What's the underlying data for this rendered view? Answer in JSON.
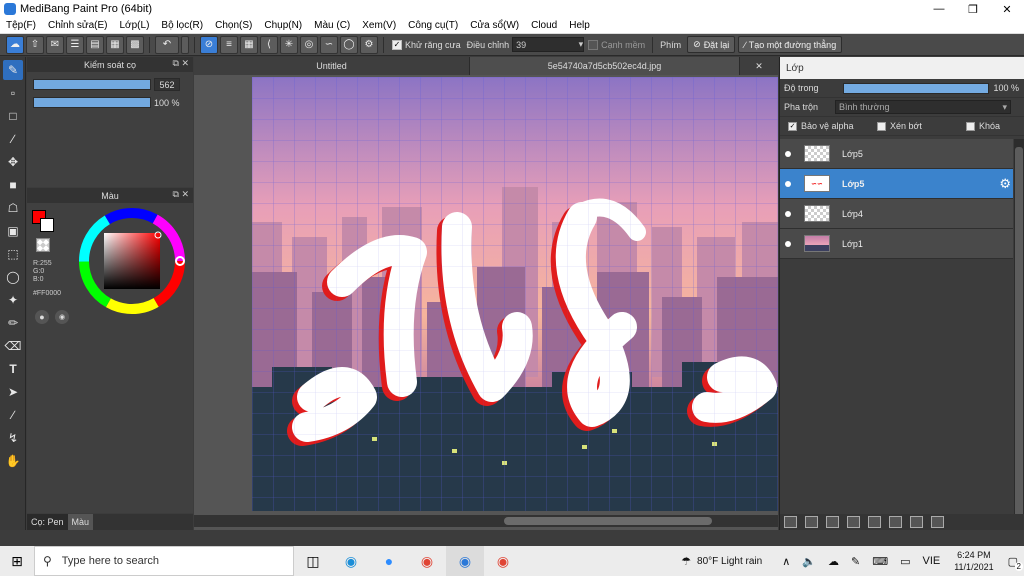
{
  "window": {
    "title": "MediBang Paint Pro (64bit)",
    "minimize_icon": "minimize-icon",
    "maximize_icon": "restore-icon",
    "close_icon": "close-icon"
  },
  "menu": [
    "Tệp(F)",
    "Chỉnh sửa(E)",
    "Lớp(L)",
    "Bộ lọc(R)",
    "Chọn(S)",
    "Chụp(N)",
    "Màu (C)",
    "Xem(V)",
    "Công cụ(T)",
    "Cửa sổ(W)",
    "Cloud",
    "Help"
  ],
  "toolbar": {
    "antialias_label": "Khử răng cưa",
    "correction_label": "Điều chỉnh",
    "correction_value": "39",
    "soft_edge_label": "Cạnh mềm",
    "keys_label": "Phím",
    "reset_label": "Đặt lại",
    "line_label": "Tạo một đường thẳng"
  },
  "brush_panel": {
    "title": "Kiểm soát cọ",
    "size_value": "562",
    "opacity_value": "100 %"
  },
  "color_panel": {
    "title": "Màu",
    "primary_color": "#FF0000",
    "r": "R:255",
    "g": "G:0",
    "b": "B:0",
    "hex": "#FF0000"
  },
  "left_tabs": [
    "Cọ: Pen",
    "Màu"
  ],
  "tabs": [
    "Untitled",
    "5e54740a7d5cb502ec4d.jpg"
  ],
  "layer_panel": {
    "title": "Lớp",
    "opacity_label": "Độ trong",
    "opacity_value": "100 %",
    "blend_label": "Pha trộn",
    "blend_value": "Bình thường",
    "protect_alpha": "Bảo vệ alpha",
    "clipping": "Xén bớt",
    "lock": "Khóa",
    "layers": [
      {
        "name": "Lớp5",
        "selected": false
      },
      {
        "name": "Lớp5",
        "selected": true
      },
      {
        "name": "Lớp4",
        "selected": false
      },
      {
        "name": "Lớp1",
        "selected": false
      }
    ]
  },
  "taskbar": {
    "search_placeholder": "Type here to search",
    "weather": "80°F  Light rain",
    "lang": "VIE",
    "time": "6:24 PM",
    "date": "11/1/2021",
    "notifications": "2"
  }
}
